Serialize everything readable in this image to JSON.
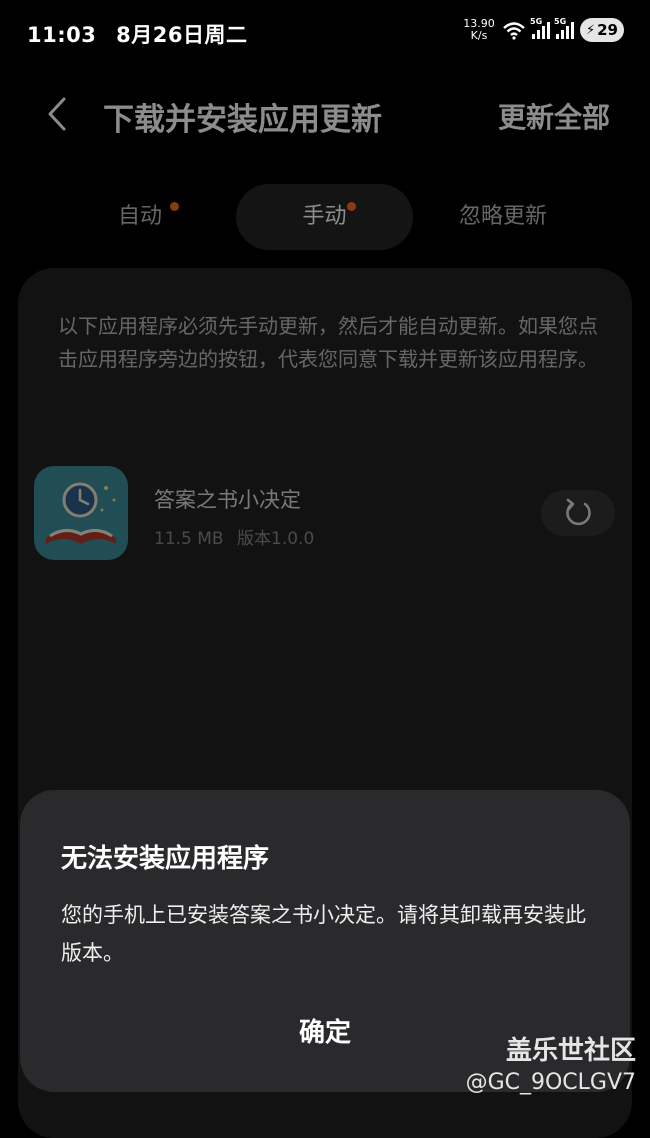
{
  "status_bar": {
    "time": "11:03",
    "date": "8月26日周二",
    "net_speed_value": "13.90",
    "net_speed_unit": "K/s",
    "signal1_label": "5G",
    "signal2_label": "5G",
    "battery": "29"
  },
  "header": {
    "title": "下载并安装应用更新",
    "update_all": "更新全部"
  },
  "tabs": [
    {
      "label": "自动",
      "has_dot": true
    },
    {
      "label": "手动",
      "has_dot": true,
      "selected": true
    },
    {
      "label": "忽略更新",
      "has_dot": false
    }
  ],
  "main": {
    "description": "以下应用程序必须先手动更新，然后才能自动更新。如果您点击应用程序旁边的按钮，代表您同意下载并更新该应用程序。",
    "app": {
      "name": "答案之书小决定",
      "size": "11.5 MB",
      "version": "版本1.0.0",
      "icon": "book-clock-icon"
    }
  },
  "dialog": {
    "title": "无法安装应用程序",
    "message": "您的手机上已安装答案之书小决定。请将其卸载再安装此版本。",
    "ok": "确定"
  },
  "watermark": {
    "site": "盖乐世社区",
    "user": "@GC_9OCLGV7"
  },
  "colors": {
    "accent_dot": "#ff6a1f",
    "dialog_bg": "#2a2a2c",
    "card_bg": "#222222"
  }
}
